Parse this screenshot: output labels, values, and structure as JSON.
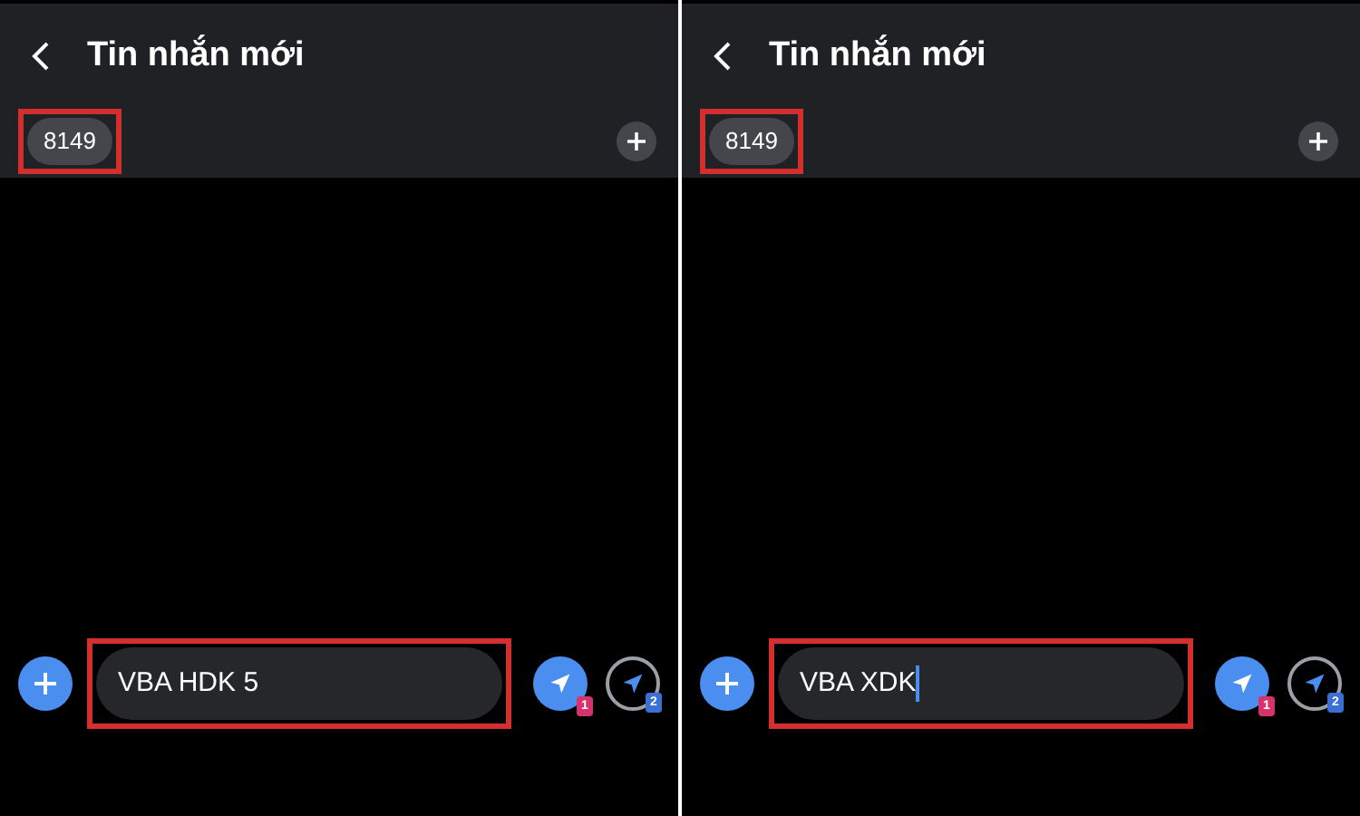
{
  "panels": [
    {
      "title": "Tin nhắn mới",
      "recipient": {
        "label": "8149",
        "highlighted": true
      },
      "message": {
        "value": "VBA HDK 5",
        "focused": false,
        "highlighted": true
      },
      "send_buttons": [
        {
          "kind": "filled",
          "sim": "1",
          "color": "#d6336c"
        },
        {
          "kind": "outline",
          "sim": "2",
          "color": "#3b6fd4"
        }
      ]
    },
    {
      "title": "Tin nhắn mới",
      "recipient": {
        "label": "8149",
        "highlighted": true
      },
      "message": {
        "value": "VBA XDK",
        "focused": true,
        "highlighted": true
      },
      "send_buttons": [
        {
          "kind": "filled",
          "sim": "1",
          "color": "#d6336c"
        },
        {
          "kind": "outline",
          "sim": "2",
          "color": "#3b6fd4"
        }
      ]
    }
  ]
}
